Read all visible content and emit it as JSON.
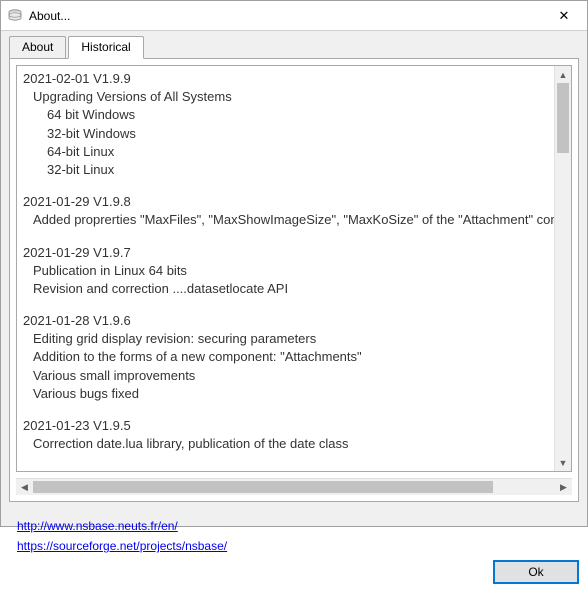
{
  "window": {
    "title": "About...",
    "close_label": "✕"
  },
  "tabs": {
    "about": "About",
    "historical": "Historical",
    "active": "historical"
  },
  "history": {
    "entries": [
      {
        "head": "2021-02-01 V1.9.9",
        "lines": [
          "Upgrading Versions of All Systems",
          "   64 bit Windows",
          "   32-bit Windows",
          "   64-bit Linux",
          "   32-bit Linux"
        ]
      },
      {
        "head": "2021-01-29 V1.9.8",
        "lines": [
          "Added proprerties \"MaxFiles\", \"MaxShowImageSize\", \"MaxKoSize\" of the \"Attachment\" comp"
        ]
      },
      {
        "head": "2021-01-29 V1.9.7",
        "lines": [
          "Publication in Linux 64 bits",
          "Revision and correction ....datasetlocate API"
        ]
      },
      {
        "head": "2021-01-28 V1.9.6",
        "lines": [
          "Editing grid display revision: securing parameters",
          "Addition to the forms of a new component: \"Attachments\"",
          "Various small improvements",
          "Various bugs fixed"
        ]
      },
      {
        "head": "2021-01-23 V1.9.5",
        "lines": [
          "Correction date.lua library, publication of the date class"
        ]
      }
    ]
  },
  "links": {
    "site": "http://www.nsbase.neuts.fr/en/",
    "sf": "https://sourceforge.net/projects/nsbase/"
  },
  "buttons": {
    "ok": "Ok"
  },
  "scroll": {
    "up": "▲",
    "down": "▼",
    "left": "◀",
    "right": "▶"
  }
}
